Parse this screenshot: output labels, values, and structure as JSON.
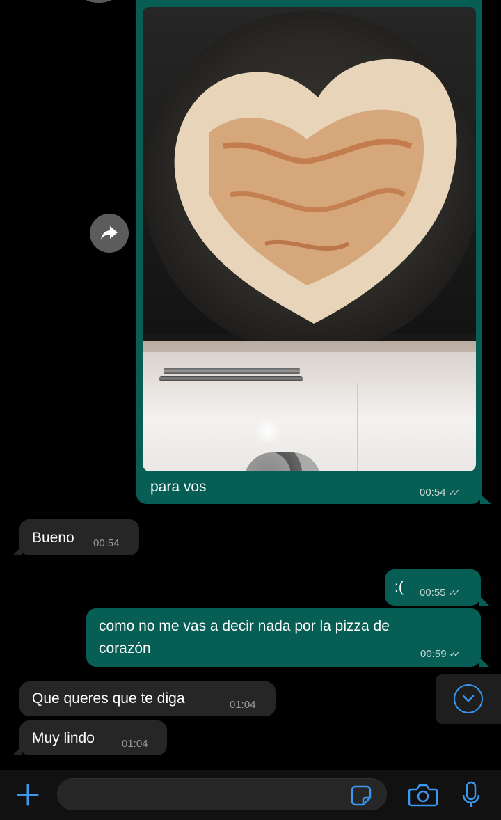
{
  "chat": {
    "messages": [
      {
        "direction": "out",
        "type": "image",
        "caption": "para vos",
        "time": "00:54",
        "status": "read"
      },
      {
        "direction": "in",
        "text": "Bueno",
        "time": "00:54"
      },
      {
        "direction": "out",
        "text": ":(",
        "time": "00:55",
        "status": "read"
      },
      {
        "direction": "out",
        "text_line1": "como no me vas a decir nada por la pizza de",
        "text_line2": "corazón",
        "time": "00:59",
        "status": "read"
      },
      {
        "direction": "in",
        "text": "Que queres que te diga",
        "time": "01:04"
      },
      {
        "direction": "in",
        "text": "Muy lindo",
        "time": "01:04"
      }
    ],
    "read_ticks": "✓✓"
  },
  "icons": {
    "forward": "forward-arrow-icon",
    "scroll_down": "chevron-down-icon",
    "attach": "plus-icon",
    "sticker": "sticker-icon",
    "camera": "camera-icon",
    "mic": "microphone-icon"
  },
  "colors": {
    "outgoing_bubble": "#075e54",
    "incoming_bubble": "#262626",
    "background": "#000000",
    "accent": "#3b97f0"
  },
  "composer": {
    "placeholder": ""
  }
}
